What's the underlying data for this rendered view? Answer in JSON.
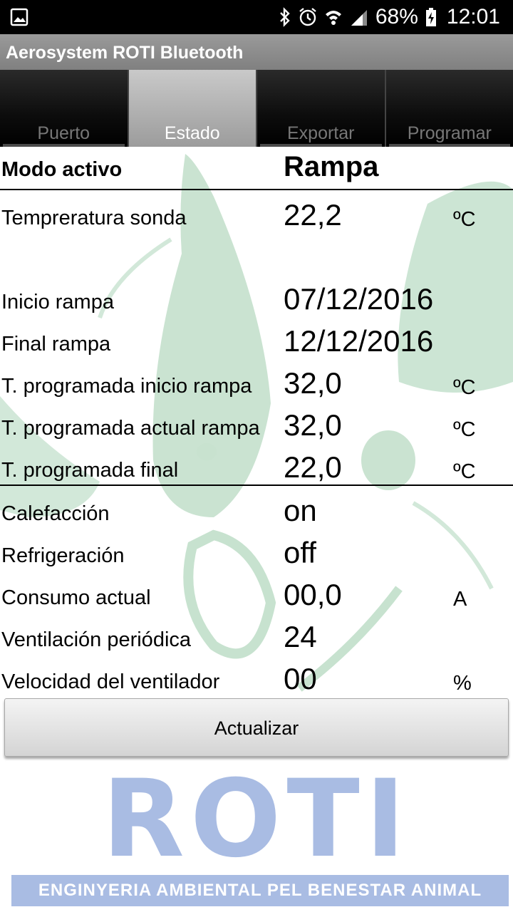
{
  "status_bar": {
    "battery_percent": "68%",
    "time": "12:01",
    "icons": [
      "image-notification-icon",
      "bluetooth-icon",
      "alarm-icon",
      "wifi-icon",
      "signal-icon",
      "battery-charging-icon"
    ]
  },
  "app": {
    "title": "Aerosystem ROTI Bluetooth"
  },
  "tabs": [
    {
      "label": "Puerto",
      "active": false
    },
    {
      "label": "Estado",
      "active": true
    },
    {
      "label": "Exportar",
      "active": false
    },
    {
      "label": "Programar",
      "active": false
    }
  ],
  "mode": {
    "label": "Modo activo",
    "value": "Rampa"
  },
  "ramp_rows": [
    {
      "label": "Tempreratura sonda",
      "value": "22,2",
      "unit": "ºC"
    },
    {
      "label": "Inicio rampa",
      "value": "07/12/2016",
      "unit": ""
    },
    {
      "label": "Final rampa",
      "value": "12/12/2016",
      "unit": ""
    },
    {
      "label": "T. programada inicio rampa",
      "value": "32,0",
      "unit": "ºC"
    },
    {
      "label": "T. programada actual rampa",
      "value": "32,0",
      "unit": "ºC"
    },
    {
      "label": "T. programada final",
      "value": "22,0",
      "unit": "ºC"
    }
  ],
  "device_rows": [
    {
      "label": "Calefacción",
      "value": "on",
      "unit": ""
    },
    {
      "label": "Refrigeración",
      "value": "off",
      "unit": ""
    },
    {
      "label": "Consumo actual",
      "value": "00,0",
      "unit": "A"
    },
    {
      "label": "Ventilación periódica",
      "value": "24",
      "unit": ""
    },
    {
      "label": "Velocidad del ventilador",
      "value": "00",
      "unit": "%"
    }
  ],
  "actions": {
    "refresh_label": "Actualizar"
  },
  "branding": {
    "logo_text": "ROTI",
    "tagline": "ENGINYERIA AMBIENTAL PEL BENESTAR ANIMAL"
  },
  "colors": {
    "logo_blue": "#a9bce3",
    "watermark_green": "#c7e2cf",
    "title_bar": "#8c8c8c"
  }
}
